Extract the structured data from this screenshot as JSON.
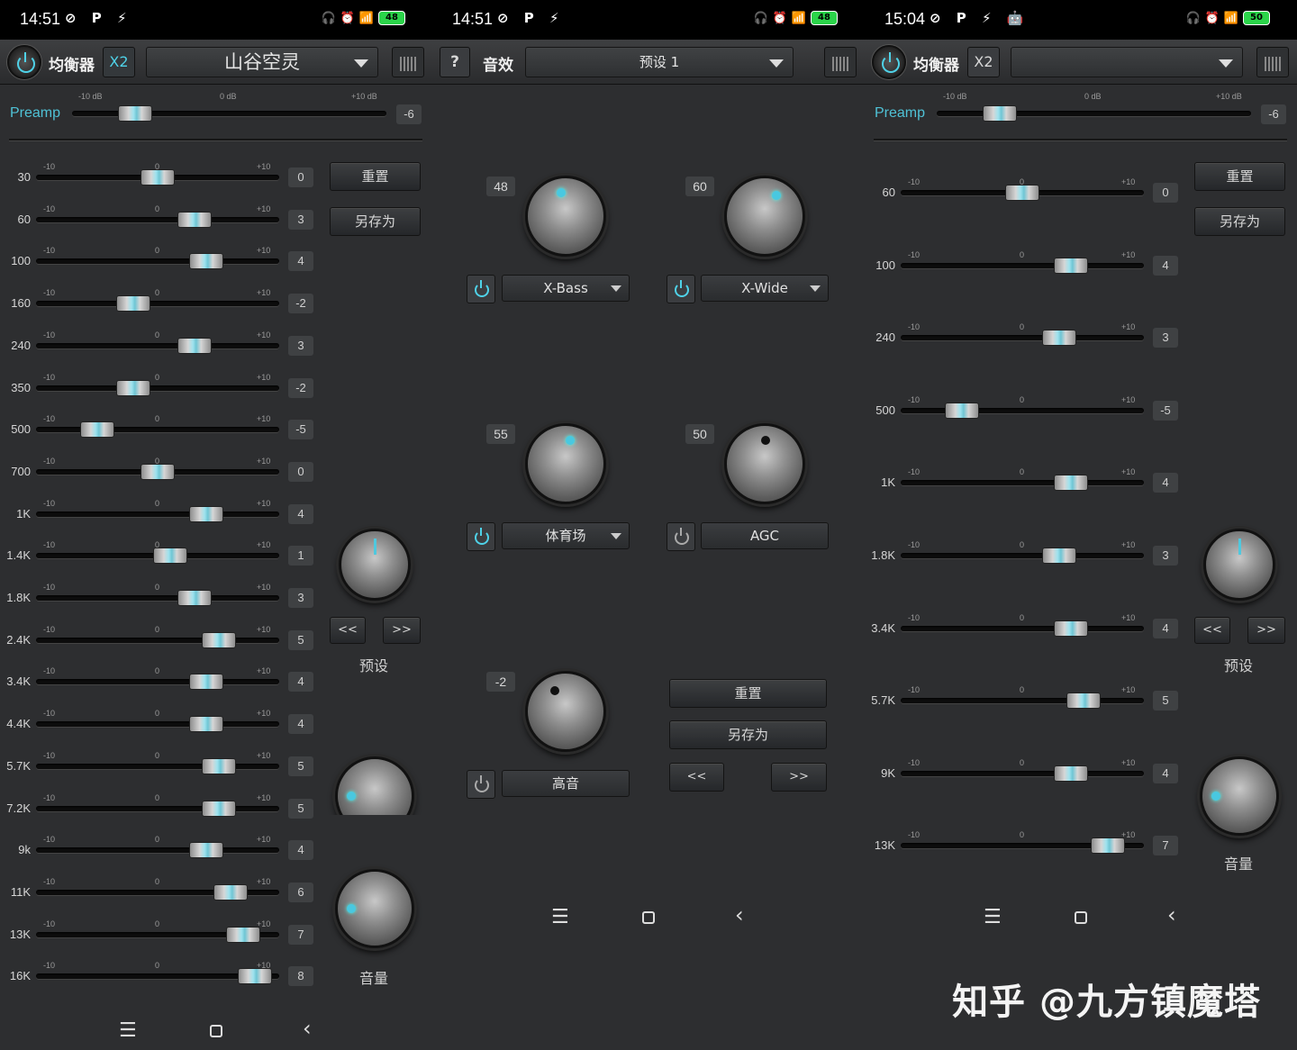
{
  "screens": [
    {
      "status": {
        "time": "14:51",
        "left_icons": "⊘ P ⚡",
        "battery": "48"
      },
      "toolbar": {
        "title": "均衡器",
        "x2": "X2",
        "preset": "山谷空灵"
      },
      "preamp": {
        "label": "Preamp",
        "min": "-10 dB",
        "mid": "0 dB",
        "max": "+10 dB",
        "value": "-6",
        "level": -6
      },
      "bands": [
        {
          "freq": "30",
          "value": "0",
          "level": 0
        },
        {
          "freq": "60",
          "value": "3",
          "level": 3
        },
        {
          "freq": "100",
          "value": "4",
          "level": 4
        },
        {
          "freq": "160",
          "value": "-2",
          "level": -2
        },
        {
          "freq": "240",
          "value": "3",
          "level": 3
        },
        {
          "freq": "350",
          "value": "-2",
          "level": -2
        },
        {
          "freq": "500",
          "value": "-5",
          "level": -5
        },
        {
          "freq": "700",
          "value": "0",
          "level": 0
        },
        {
          "freq": "1K",
          "value": "4",
          "level": 4
        },
        {
          "freq": "1.4K",
          "value": "1",
          "level": 1
        },
        {
          "freq": "1.8K",
          "value": "3",
          "level": 3
        },
        {
          "freq": "2.4K",
          "value": "5",
          "level": 5
        },
        {
          "freq": "3.4K",
          "value": "4",
          "level": 4
        },
        {
          "freq": "4.4K",
          "value": "4",
          "level": 4
        },
        {
          "freq": "5.7K",
          "value": "5",
          "level": 5
        },
        {
          "freq": "7.2K",
          "value": "5",
          "level": 5
        },
        {
          "freq": "9k",
          "value": "4",
          "level": 4
        },
        {
          "freq": "11K",
          "value": "6",
          "level": 6
        },
        {
          "freq": "13K",
          "value": "7",
          "level": 7
        },
        {
          "freq": "16K",
          "value": "8",
          "level": 8
        }
      ],
      "tick_min": "-10",
      "tick_mid": "0",
      "tick_max": "+10",
      "reset": "重置",
      "save_as": "另存为",
      "prev": "<<",
      "next": ">>",
      "preset_label": "预设",
      "volume_label": "音量"
    },
    {
      "status": {
        "time": "14:51",
        "left_icons": "⊘ P ⚡",
        "battery": "48"
      },
      "toolbar": {
        "help": "?",
        "title": "音效",
        "preset": "预设 1"
      },
      "effects": [
        {
          "name": "X-Bass",
          "value": "48"
        },
        {
          "name": "X-Wide",
          "value": "60"
        },
        {
          "name": "体育场",
          "value": "55"
        },
        {
          "name": "AGC",
          "value": "50"
        },
        {
          "name": "高音",
          "value": "-2"
        }
      ],
      "reset": "重置",
      "save_as": "另存为",
      "prev": "<<",
      "next": ">>"
    },
    {
      "status": {
        "time": "15:04",
        "left_icons": "⊘ P ⚡ 🤖",
        "battery": "50"
      },
      "toolbar": {
        "title": "均衡器",
        "x2": "X2",
        "preset": ""
      },
      "preamp": {
        "label": "Preamp",
        "min": "-10 dB",
        "mid": "0 dB",
        "max": "+10 dB",
        "value": "-6",
        "level": -6
      },
      "bands": [
        {
          "freq": "60",
          "value": "0",
          "level": 0
        },
        {
          "freq": "100",
          "value": "4",
          "level": 4
        },
        {
          "freq": "240",
          "value": "3",
          "level": 3
        },
        {
          "freq": "500",
          "value": "-5",
          "level": -5
        },
        {
          "freq": "1K",
          "value": "4",
          "level": 4
        },
        {
          "freq": "1.8K",
          "value": "3",
          "level": 3
        },
        {
          "freq": "3.4K",
          "value": "4",
          "level": 4
        },
        {
          "freq": "5.7K",
          "value": "5",
          "level": 5
        },
        {
          "freq": "9K",
          "value": "4",
          "level": 4
        },
        {
          "freq": "13K",
          "value": "7",
          "level": 7
        }
      ],
      "tick_min": "-10",
      "tick_mid": "0",
      "tick_max": "+10",
      "reset": "重置",
      "save_as": "另存为",
      "prev": "<<",
      "next": ">>",
      "preset_label": "预设",
      "volume_label": "音量"
    }
  ],
  "nav": {
    "menu": "☰",
    "back": "‹"
  },
  "watermark": "知乎 @九方镇魔塔",
  "colors": {
    "accent": "#4fd2e8",
    "background": "#2d2e30"
  }
}
